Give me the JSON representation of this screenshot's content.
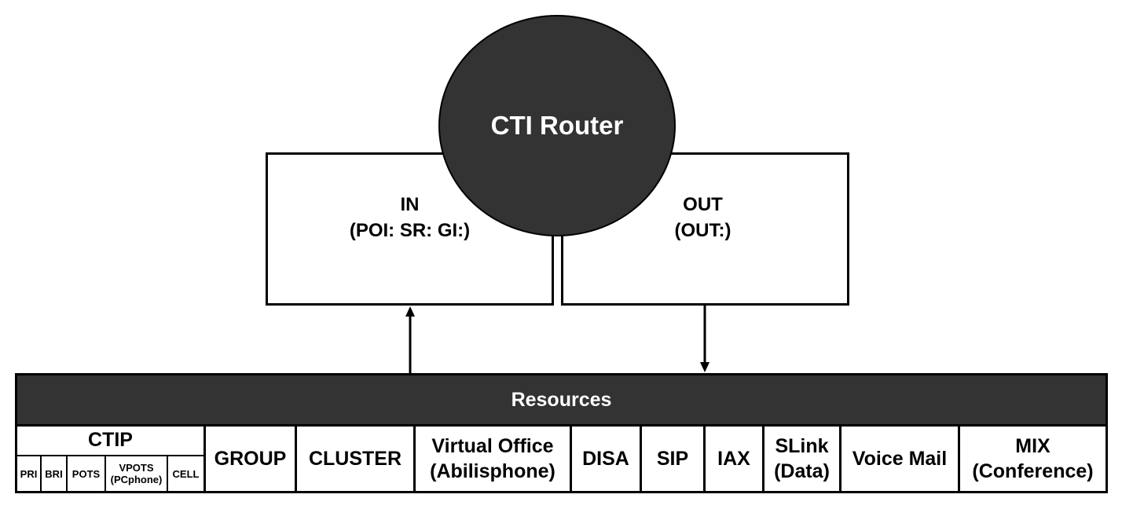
{
  "diagram": {
    "router": {
      "label": "CTI Router"
    },
    "in_box": {
      "title": "IN",
      "subtitle": "(POI: SR: GI:)"
    },
    "out_box": {
      "title": "OUT",
      "subtitle": "(OUT:)"
    },
    "resources": {
      "label": "Resources",
      "ctip": {
        "label": "CTIP",
        "sub": [
          {
            "label": "PRI"
          },
          {
            "label": "BRI"
          },
          {
            "label": "POTS"
          },
          {
            "label": "VPOTS",
            "label2": "(PCphone)"
          },
          {
            "label": "CELL"
          }
        ]
      },
      "items": [
        {
          "line1": "GROUP"
        },
        {
          "line1": "CLUSTER"
        },
        {
          "line1": "Virtual Office",
          "line2": "(Abilisphone)"
        },
        {
          "line1": "DISA"
        },
        {
          "line1": "SIP"
        },
        {
          "line1": "IAX"
        },
        {
          "line1": "SLink",
          "line2": "(Data)"
        },
        {
          "line1": "Voice Mail"
        },
        {
          "line1": "MIX",
          "line2": "(Conference)"
        }
      ]
    },
    "colors": {
      "dark_fill": "#333333",
      "stroke": "#000000",
      "background": "#ffffff"
    }
  }
}
